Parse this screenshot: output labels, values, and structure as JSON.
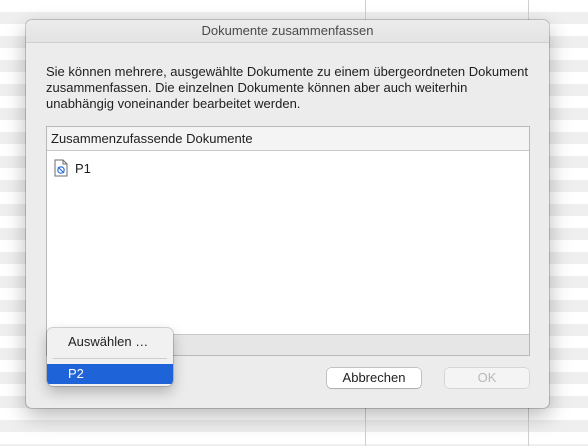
{
  "dialog": {
    "title": "Dokumente zusammenfassen",
    "description": "Sie können mehrere, ausgewählte Dokumente zu einem übergeordneten Dokument zusammenfassen. Die einzelnen Dokumente können aber auch weiterhin unabhängig voneinander bearbeitet werden.",
    "list": {
      "header": "Zusammenzufassende Dokumente",
      "items": [
        {
          "label": "P1",
          "icon": "document-icon"
        }
      ]
    },
    "buttons": {
      "cancel": "Abbrechen",
      "ok": "OK"
    }
  },
  "popup_menu": {
    "items": [
      {
        "label": "Auswählen …"
      },
      {
        "label": "P2",
        "selected": true
      }
    ]
  },
  "colors": {
    "selection": "#1e63d8",
    "dialog_bg": "#ececec"
  }
}
